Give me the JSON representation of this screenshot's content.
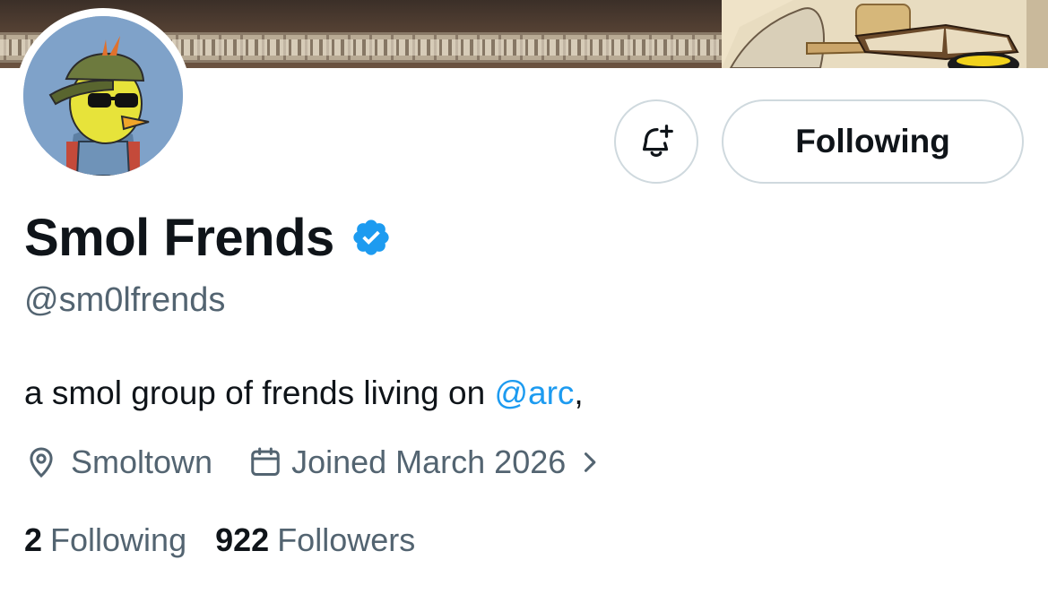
{
  "profile": {
    "display_name": "Smol Frends",
    "verified": true,
    "handle": "@sm0lfrends",
    "bio_text": "a smol group of frends living on ",
    "bio_mention": "@arc",
    "bio_suffix": ",",
    "location": "Smoltown",
    "joined": "Joined March 2026"
  },
  "actions": {
    "notify_icon": "bell-plus-icon",
    "follow_label": "Following"
  },
  "stats": {
    "following_count": "2",
    "following_label": "Following",
    "followers_count": "922",
    "followers_label": "Followers"
  },
  "colors": {
    "accent": "#1d9bf0",
    "text_primary": "#0f1419",
    "text_secondary": "#536471",
    "border": "#cfd9de"
  }
}
